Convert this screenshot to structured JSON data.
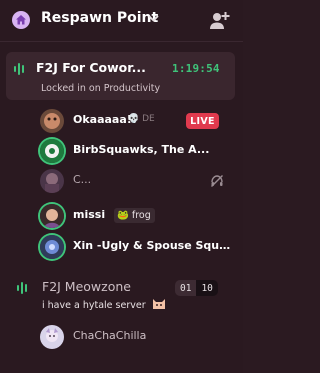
{
  "header": {
    "server_name": "Respawn Point",
    "server_icon": "home-icon",
    "dropdown_icon": "chevron-down-icon",
    "invite_icon": "add-user-icon"
  },
  "voice_channels": [
    {
      "name": "F2J For Cowor...",
      "timer": "1:19:54",
      "status": "Locked in on Productivity",
      "icon": "voice-channel-icon",
      "members": [
        {
          "name": "Okaaaaa!!",
          "status_text": "💀 DE",
          "badge": "LIVE",
          "speaking": false
        },
        {
          "name": "BirbSquawks, The A...",
          "speaking": true
        },
        {
          "name": "C...",
          "muted_icon": "deafened-icon",
          "speaking": false
        },
        {
          "name": "missi",
          "tag_emoji": "🐸",
          "tag_text": "frog",
          "speaking": true
        },
        {
          "name": "Xin -Ugly & Spouse Squad...",
          "speaking": true
        }
      ]
    },
    {
      "name": "F2J Meowzone",
      "topic": "i have a hytale server",
      "topic_emoji": "cat-emoji",
      "user_count": "01",
      "user_limit": "10",
      "icon": "voice-channel-icon",
      "members": [
        {
          "name": "ChaChaChilla",
          "speaking": false
        }
      ]
    }
  ],
  "colors": {
    "background": "#2a1920",
    "active_channel_bg": "#3a262e",
    "timer_green": "#3fc47a",
    "live_red": "#e03a4e",
    "speaking_ring": "#3fc47a"
  }
}
